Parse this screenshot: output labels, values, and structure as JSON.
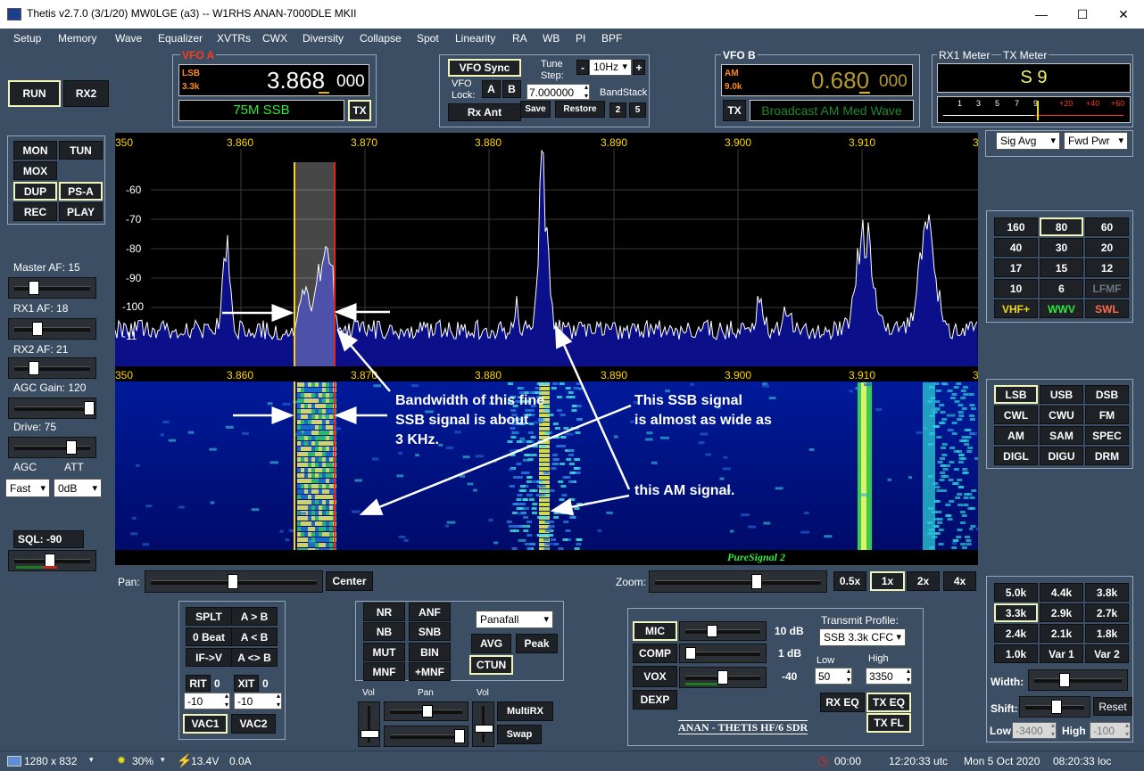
{
  "window": {
    "title": "Thetis v2.7.0 (3/1/20) MW0LGE (a3)   --   W1RHS ANAN-7000DLE MKII"
  },
  "menu": [
    "Setup",
    "Memory",
    "Wave",
    "Equalizer",
    "XVTRs",
    "CWX",
    "Diversity",
    "Collapse",
    "Spot",
    "Linearity",
    "RA",
    "WB",
    "PI",
    "BPF"
  ],
  "run_buttons": {
    "run": "RUN",
    "rx2": "RX2"
  },
  "transmit_buttons": {
    "mon": "MON",
    "tun": "TUN",
    "mox": "MOX",
    "dup": "DUP",
    "psa": "PS-A",
    "rec": "REC",
    "play": "PLAY"
  },
  "sliders": {
    "master_af": "Master AF:  15",
    "rx1_af": "RX1 AF:  18",
    "rx2_af": "RX2 AF:  21",
    "agc_gain": "AGC Gain:  120",
    "drive": "Drive:  75",
    "agc": "AGC",
    "att": "ATT",
    "agc_value": "Fast",
    "att_value": "0dB",
    "sql": "SQL: -90"
  },
  "vfo_a": {
    "label": "VFO A",
    "mode": "LSB",
    "bw": "3.3k",
    "freq_main": "3.868",
    "freq_sub": "000",
    "band": "75M SSB",
    "tx": "TX"
  },
  "vfo_mid": {
    "sync": "VFO Sync",
    "tune": "Tune",
    "step": "Step:",
    "step_value": "10Hz",
    "minus": "-",
    "plus": "+",
    "lock1": "VFO",
    "lock2": "Lock:",
    "a": "A",
    "b": "B",
    "rxant": "Rx Ant",
    "freq": "7.000000",
    "bandstack": "BandStack",
    "save": "Save",
    "restore": "Restore",
    "bs2": "2",
    "bs5": "5"
  },
  "vfo_b": {
    "label": "VFO B",
    "mode": "AM",
    "bw": "9.0k",
    "freq_main": "0.680",
    "freq_sub": "000",
    "band": "Broadcast AM Med Wave",
    "tx": "TX"
  },
  "meters": {
    "rx1": "RX1 Meter",
    "tx": "TX Meter",
    "reading": "S 9",
    "scale": [
      "1",
      "3",
      "5",
      "7",
      "9",
      "+20",
      "+40",
      "+60"
    ],
    "rx_mode": "Sig Avg",
    "tx_mode": "Fwd Pwr"
  },
  "panadapter": {
    "freq_labels": [
      "350",
      "3.860",
      "3.870",
      "3.880",
      "3.890",
      "3.900",
      "3.910",
      "3"
    ],
    "db_labels": [
      "-60",
      "-70",
      "-80",
      "-90",
      "-100",
      "-11"
    ],
    "puresignal": "PureSignal 2"
  },
  "annotations": {
    "bw_text": [
      "Bandwidth of this fine",
      "SSB signal is about",
      "3 KHz."
    ],
    "ssb_text": [
      "This SSB signal",
      "is almost as wide as"
    ],
    "am_text": "this AM signal."
  },
  "bands": [
    "160",
    "80",
    "60",
    "40",
    "30",
    "20",
    "17",
    "15",
    "12",
    "10",
    "6",
    "LFMF",
    "VHF+",
    "WWV",
    "SWL"
  ],
  "modes": [
    "LSB",
    "USB",
    "DSB",
    "CWL",
    "CWU",
    "FM",
    "AM",
    "SAM",
    "SPEC",
    "DIGL",
    "DIGU",
    "DRM"
  ],
  "filters": [
    "5.0k",
    "4.4k",
    "3.8k",
    "3.3k",
    "2.9k",
    "2.7k",
    "2.4k",
    "2.1k",
    "1.8k",
    "1.0k",
    "Var 1",
    "Var 2"
  ],
  "filter_controls": {
    "width": "Width:",
    "shift": "Shift:",
    "reset": "Reset",
    "low": "Low",
    "high": "High",
    "low_value": "-3400",
    "high_value": "-100"
  },
  "pan_zoom": {
    "pan": "Pan:",
    "center": "Center",
    "zoom": "Zoom:",
    "z05": "0.5x",
    "z1": "1x",
    "z2": "2x",
    "z4": "4x"
  },
  "rit_xit": {
    "splt": "SPLT",
    "atob": "A > B",
    "zerobeat": "0 Beat",
    "altb": "A < B",
    "ifv": "IF->V",
    "aswap": "A <> B",
    "rit": "RIT",
    "rit_val": "0",
    "xit": "XIT",
    "xit_val": "0",
    "rit_spin": "-10",
    "xit_spin": "-10",
    "vac1": "VAC1",
    "vac2": "VAC2"
  },
  "dsp": {
    "nr": "NR",
    "anf": "ANF",
    "nb": "NB",
    "snb": "SNB",
    "mut": "MUT",
    "bin": "BIN",
    "mnf": "MNF",
    "pmnf": "+MNF",
    "display": "Panafall",
    "avg": "AVG",
    "peak": "Peak",
    "ctun": "CTUN",
    "vol": "Vol",
    "pan": "Pan",
    "vol2": "Vol",
    "multirx": "MultiRX",
    "swap": "Swap"
  },
  "tx_controls": {
    "mic": "MIC",
    "mic_db": "10 dB",
    "comp": "COMP",
    "comp_db": "1 dB",
    "vox": "VOX",
    "vox_db": "-40",
    "dexp": "DEXP",
    "profile_label": "Transmit Profile:",
    "profile": "SSB 3.3k CFC",
    "low": "Low",
    "high": "High",
    "low_val": "50",
    "high_val": "3350",
    "rxeq": "RX EQ",
    "txeq": "TX EQ",
    "txfl": "TX FL",
    "brand": "ANAN - THETIS HF/6 SDR"
  },
  "status": {
    "res": "1280 x 832",
    "cpu": "30%",
    "volt": "13.4V",
    "amp": "0.0A",
    "timer": "00:00",
    "utc": "12:20:33 utc",
    "date": "Mon 5 Oct 2020",
    "loc": "08:20:33 loc"
  },
  "colors": {
    "bg": "#3b4e63",
    "spectrum": "#0b0f8a",
    "trace": "#ffffff",
    "vfo_digits": "#ffffff",
    "vfo_b_digits": "#b59a2b",
    "band_green": "#2eea3a",
    "accent_yellow": "#f2f5b8"
  }
}
